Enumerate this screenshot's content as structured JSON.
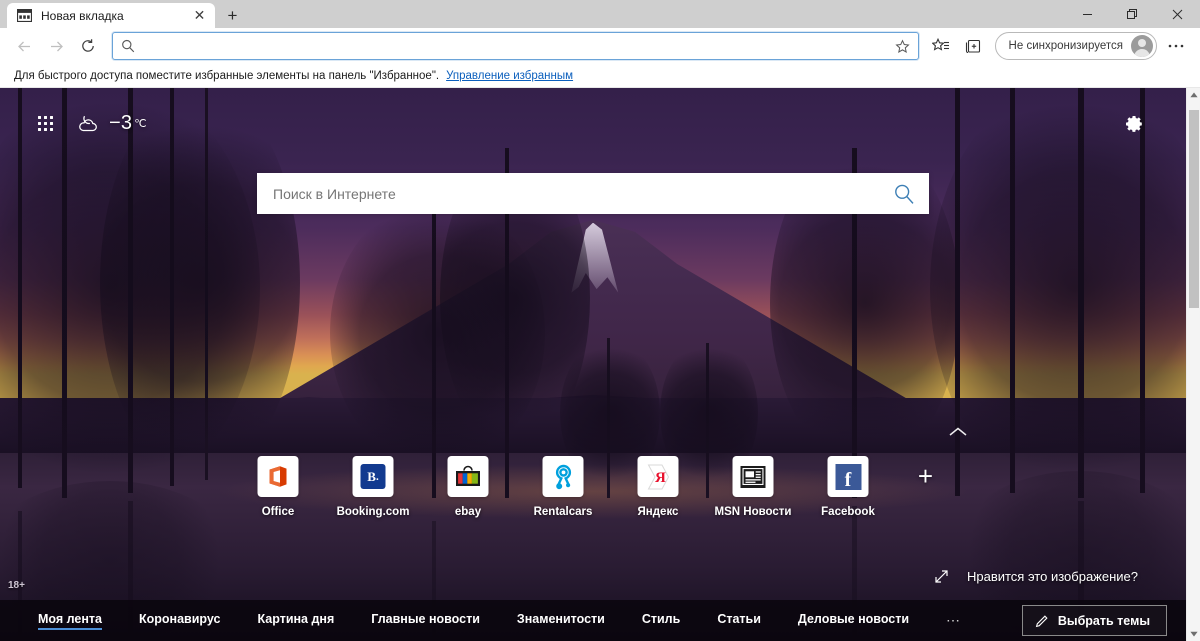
{
  "window": {
    "minimize_label": "—",
    "maximize_label": "❐",
    "close_label": "✕"
  },
  "tabs": {
    "items": [
      {
        "title": "Новая вкладка",
        "favicon": "newtab-icon",
        "close_label": "✕"
      }
    ],
    "new_tab_label": "+"
  },
  "toolbar": {
    "back_label": "←",
    "forward_label": "→",
    "refresh_label": "↻",
    "address_value": "",
    "address_placeholder": "",
    "favorite_label": "☆",
    "collections_label": "collections-icon",
    "favorites_hub_label": "favorites-icon",
    "profile_label": "Не синхронизируется",
    "settings_more_label": "⋯"
  },
  "favorites_bar": {
    "message": "Для быстрого доступа поместите избранные элементы на панель \"Избранное\".",
    "link": "Управление избранным"
  },
  "newtab": {
    "weather": {
      "temperature": "−3",
      "unit": "℃",
      "condition_icon": "moon-cloud-icon",
      "apps_icon": "app-grid-icon"
    },
    "settings_icon": "gear-icon",
    "search": {
      "placeholder": "Поиск в Интернете",
      "value": "",
      "submit_icon": "search-icon"
    },
    "tiles": [
      {
        "label": "Office",
        "icon": "office-icon"
      },
      {
        "label": "Booking.com",
        "icon": "booking-icon"
      },
      {
        "label": "ebay",
        "icon": "ebay-icon"
      },
      {
        "label": "Rentalcars",
        "icon": "rentalcars-icon"
      },
      {
        "label": "Яндекс",
        "icon": "yandex-icon"
      },
      {
        "label": "MSN Новости",
        "icon": "msn-icon"
      },
      {
        "label": "Facebook",
        "icon": "facebook-icon"
      }
    ],
    "add_tile_label": "+",
    "scroll_up_label": "⌃",
    "like_image": {
      "label": "Нравится это изображение?",
      "icon": "expand-arrow-icon"
    },
    "age_badge": "18+",
    "news": {
      "items": [
        {
          "label": "Моя лента",
          "active": true
        },
        {
          "label": "Коронавирус",
          "active": false
        },
        {
          "label": "Картина дня",
          "active": false
        },
        {
          "label": "Главные новости",
          "active": false
        },
        {
          "label": "Знаменитости",
          "active": false
        },
        {
          "label": "Стиль",
          "active": false
        },
        {
          "label": "Статьи",
          "active": false
        },
        {
          "label": "Деловые новости",
          "active": false
        }
      ],
      "more_label": "⋯",
      "choose_themes_label": "Выбрать темы",
      "choose_themes_icon": "pencil-icon",
      "active_underline_color": "#4c8fd6"
    }
  },
  "scrollbar": {
    "up_label": "▲",
    "down_label": "▼"
  }
}
